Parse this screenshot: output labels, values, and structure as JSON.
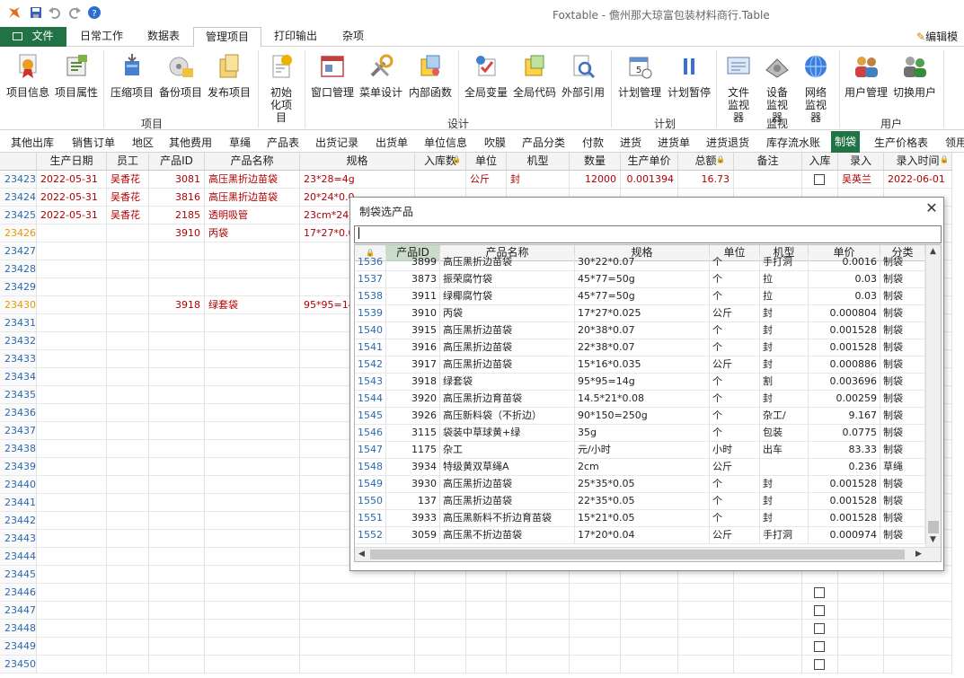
{
  "window": {
    "title": "Foxtable - 儋州那大琼富包装材料商行.Table"
  },
  "ribbon_tabs": [
    "文件",
    "日常工作",
    "数据表",
    "管理项目",
    "打印输出",
    "杂项"
  ],
  "active_ribbon_tab": "管理项目",
  "edit_mode": "编辑模",
  "ribbon": {
    "groups": {
      "project": {
        "label": "项目",
        "buttons": [
          "项目信息",
          "项目属性",
          "压缩项目",
          "备份项目",
          "发布项目",
          "初始化项目"
        ]
      },
      "design": {
        "label": "设计",
        "buttons": [
          "窗口管理",
          "菜单设计",
          "内部函数",
          "全局变量",
          "全局代码",
          "外部引用"
        ]
      },
      "plan": {
        "label": "计划",
        "buttons": [
          "计划管理",
          "计划暂停"
        ]
      },
      "monitor": {
        "label": "监视",
        "buttons": [
          "文件监视器",
          "设备监视器",
          "网络监视器"
        ]
      },
      "user": {
        "label": "用户",
        "buttons": [
          "用户管理",
          "切换用户"
        ]
      }
    }
  },
  "table_tabs": [
    "其他出库",
    "销售订单",
    "地区",
    "其他费用",
    "草绳",
    "产品表",
    "出货记录",
    "出货单",
    "单位信息",
    "吹膜",
    "产品分类",
    "付款",
    "进货",
    "进货单",
    "进货退货",
    "库存流水账",
    "制袋",
    "生产价格表",
    "领用"
  ],
  "active_table_tab": "制袋",
  "main_grid": {
    "headers": [
      "生产日期",
      "员工",
      "产品ID",
      "产品名称",
      "规格",
      "入库数",
      "单位",
      "机型",
      "数量",
      "生产单价",
      "总额",
      "备注",
      "入库",
      "录入",
      "录入时间"
    ],
    "rows": [
      {
        "n": "23423",
        "date": "2022-05-31",
        "emp": "吴香花",
        "pid": "3081",
        "name": "高压黑折边苗袋",
        "spec": "23*28=4g",
        "unit": "公斤",
        "model": "封",
        "qty": "12000",
        "price": "0.001394",
        "total": "16.73",
        "chk": true,
        "entry": "吴英兰",
        "time": "2022-06-01"
      },
      {
        "n": "23424",
        "date": "2022-05-31",
        "emp": "吴香花",
        "pid": "3816",
        "name": "高压黑折边苗袋",
        "spec": "20*24*0.0"
      },
      {
        "n": "23425",
        "date": "2022-05-31",
        "emp": "吴香花",
        "pid": "2185",
        "name": "透明吸管",
        "spec": "23cm*24支"
      },
      {
        "n": "23426",
        "pid": "3910",
        "name": "丙袋",
        "spec": "17*27*0.0"
      },
      {
        "n": "23427"
      },
      {
        "n": "23428"
      },
      {
        "n": "23429"
      },
      {
        "n": "23430",
        "pid": "3918",
        "name": "绿套袋",
        "spec": "95*95=14g"
      },
      {
        "n": "23431"
      },
      {
        "n": "23432"
      },
      {
        "n": "23433"
      },
      {
        "n": "23434"
      },
      {
        "n": "23435"
      },
      {
        "n": "23436"
      },
      {
        "n": "23437"
      },
      {
        "n": "23438"
      },
      {
        "n": "23439"
      },
      {
        "n": "23440"
      },
      {
        "n": "23441"
      },
      {
        "n": "23442"
      },
      {
        "n": "23443"
      },
      {
        "n": "23444"
      },
      {
        "n": "23445"
      },
      {
        "n": "23446"
      },
      {
        "n": "23447"
      },
      {
        "n": "23448"
      },
      {
        "n": "23449"
      },
      {
        "n": "23450"
      }
    ]
  },
  "dialog": {
    "title": "制袋选产品",
    "search_value": "",
    "headers": [
      "产品ID",
      "产品名称",
      "规格",
      "单位",
      "机型",
      "单价",
      "分类"
    ],
    "rows": [
      [
        "1536",
        "3899",
        "高压黑折边苗袋",
        "30*22*0.07",
        "个",
        "手打洞",
        "0.0016",
        "制袋"
      ],
      [
        "1537",
        "3873",
        "振荣腐竹袋",
        "45*77=50g",
        "个",
        "拉",
        "0.03",
        "制袋"
      ],
      [
        "1538",
        "3911",
        "绿椰腐竹袋",
        "45*77=50g",
        "个",
        "拉",
        "0.03",
        "制袋"
      ],
      [
        "1539",
        "3910",
        "丙袋",
        "17*27*0.025",
        "公斤",
        "封",
        "0.000804",
        "制袋"
      ],
      [
        "1540",
        "3915",
        "高压黑折边苗袋",
        "20*38*0.07",
        "个",
        "封",
        "0.001528",
        "制袋"
      ],
      [
        "1541",
        "3916",
        "高压黑折边苗袋",
        "22*38*0.07",
        "个",
        "封",
        "0.001528",
        "制袋"
      ],
      [
        "1542",
        "3917",
        "高压黑折边苗袋",
        "15*16*0.035",
        "公斤",
        "封",
        "0.000886",
        "制袋"
      ],
      [
        "1543",
        "3918",
        "绿套袋",
        "95*95=14g",
        "个",
        "割",
        "0.003696",
        "制袋"
      ],
      [
        "1544",
        "3920",
        "高压黑折边育苗袋",
        "14.5*21*0.08",
        "个",
        "封",
        "0.00259",
        "制袋"
      ],
      [
        "1545",
        "3926",
        "高压新料袋（不折边）",
        "90*150=250g",
        "个",
        "杂工/",
        "9.167",
        "制袋"
      ],
      [
        "1546",
        "3115",
        "袋装中草球黄+绿",
        "35g",
        "个",
        "包装",
        "0.0775",
        "制袋"
      ],
      [
        "1547",
        "1175",
        "杂工",
        "元/小时",
        "小时",
        "出车",
        "83.33",
        "制袋"
      ],
      [
        "1548",
        "3934",
        "特级黄双草绳A",
        "2cm",
        "公斤",
        "",
        "0.236",
        "草绳"
      ],
      [
        "1549",
        "3930",
        "高压黑折边苗袋",
        "25*35*0.05",
        "个",
        "封",
        "0.001528",
        "制袋"
      ],
      [
        "1550",
        "137",
        "高压黑折边苗袋",
        "22*35*0.05",
        "个",
        "封",
        "0.001528",
        "制袋"
      ],
      [
        "1551",
        "3933",
        "高压黑新料不折边育苗袋",
        "15*21*0.05",
        "个",
        "封",
        "0.001528",
        "制袋"
      ],
      [
        "1552",
        "3059",
        "高压黑不折边苗袋",
        "17*20*0.04",
        "公斤",
        "手打洞",
        "0.000974",
        "制袋"
      ]
    ]
  },
  "colors": {
    "accent_green": "#217346",
    "row_number_blue": "#2a6ab0",
    "row_number_highlight": "#e69b00",
    "data_red": "#b00000"
  }
}
